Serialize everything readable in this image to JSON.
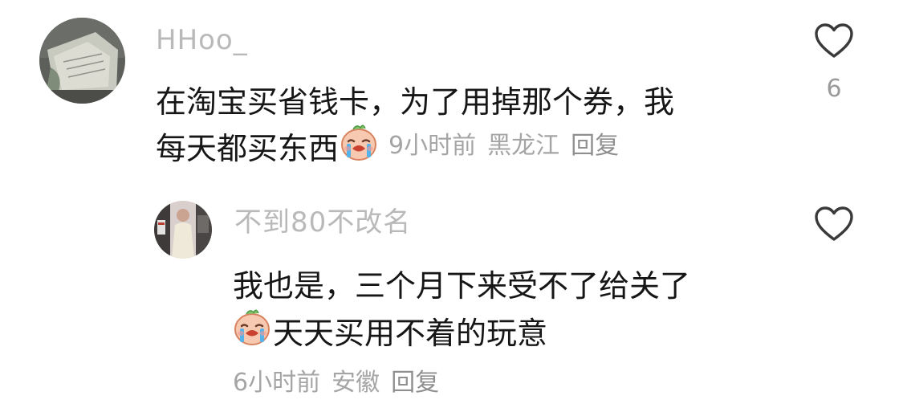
{
  "comments": [
    {
      "username": "HHoo_",
      "text_line1": "在淘宝买省钱卡，为了用掉那个券，我",
      "text_line2": "每天都买东西",
      "emoji": "crying-face-emoji",
      "time": "9小时前",
      "location": "黑龙江",
      "reply_label": "回复",
      "like_count": "6",
      "like_icon": "heart-outline-icon"
    },
    {
      "username": "不到80不改名",
      "text_line1": "我也是，三个月下来受不了给关了",
      "emoji": "crying-face-emoji",
      "text_line2": "天天买用不着的玩意",
      "time": "6小时前",
      "location": "安徽",
      "reply_label": "回复",
      "like_icon": "heart-outline-icon"
    }
  ],
  "colors": {
    "username": "#b9b9b9",
    "body_text": "#161616",
    "meta_text": "#a5a5a5",
    "heart": "#3a3a3a"
  }
}
